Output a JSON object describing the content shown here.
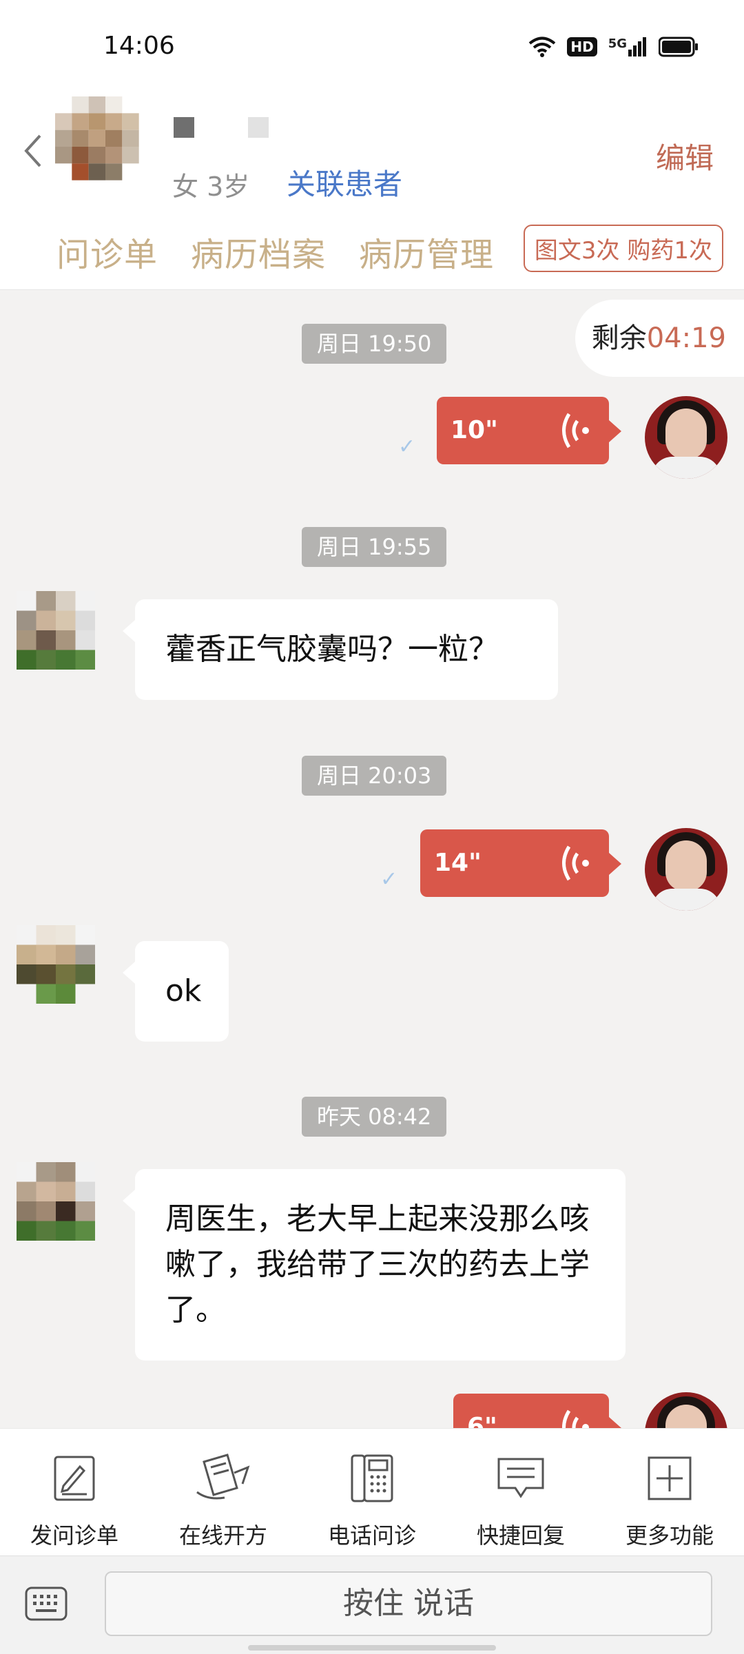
{
  "status_bar": {
    "time": "14:06",
    "badge_hd": "HD",
    "badge_5g": "5G"
  },
  "header": {
    "gender_age": "女 3岁",
    "link_patient": "关联患者",
    "edit": "编辑",
    "tabs": [
      {
        "label": "问诊单"
      },
      {
        "label": "病历档案"
      },
      {
        "label": "病历管理"
      }
    ],
    "tag": "图文3次 购药1次"
  },
  "chat": {
    "remaining_label": "剩余",
    "remaining_time": "04:19",
    "messages": [
      {
        "timestamp": "周日 19:50",
        "voice_duration": "10\""
      },
      {
        "timestamp": "周日 19:55",
        "text": "藿香正气胶囊吗？一粒？"
      },
      {
        "timestamp": "周日 20:03",
        "voice_duration": "14\""
      },
      {
        "text": "ok"
      },
      {
        "timestamp": "昨天 08:42",
        "text": "周医生，老大早上起来没那么咳嗽了，我给带了三次的药去上学了。"
      },
      {
        "voice_duration": "6\""
      }
    ]
  },
  "toolbar": {
    "items": [
      {
        "label": "发问诊单",
        "icon": "questionnaire-icon"
      },
      {
        "label": "在线开方",
        "icon": "prescription-icon"
      },
      {
        "label": "电话问诊",
        "icon": "phone-icon"
      },
      {
        "label": "快捷回复",
        "icon": "quick-reply-icon"
      },
      {
        "label": "更多功能",
        "icon": "plus-icon"
      }
    ]
  },
  "input_bar": {
    "talk_label": "按住 说话",
    "keyboard_icon": "keyboard-icon"
  },
  "colors": {
    "accent": "#d9574a",
    "tab": "#c8b089",
    "link": "#4a78c8"
  }
}
